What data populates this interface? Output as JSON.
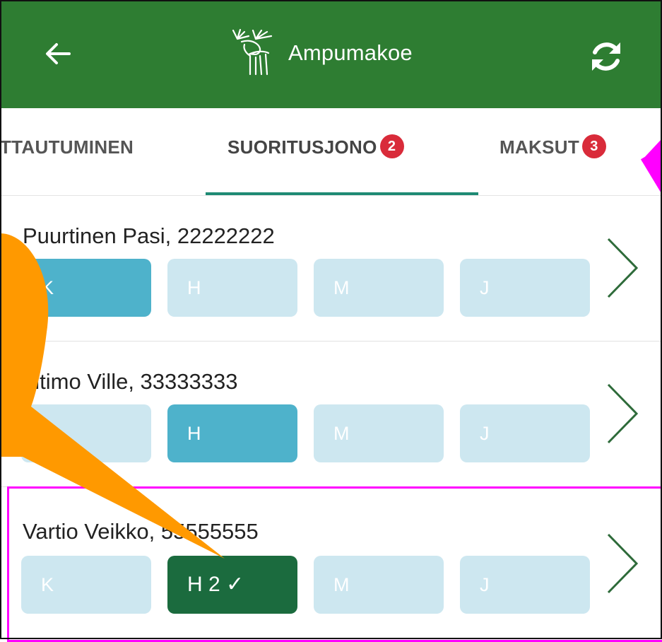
{
  "appbar": {
    "title": "Ampumakoe",
    "icons": {
      "back": "arrow-left-icon",
      "logo": "moose-logo-icon",
      "refresh": "refresh-icon"
    },
    "color": "#2e7d32"
  },
  "tabs": [
    {
      "label": "TTAUTUMINEN",
      "badge": null
    },
    {
      "label": "SUORITUSJONO",
      "badge": "2",
      "active": true
    },
    {
      "label": "MAKSUT",
      "badge": "3"
    }
  ],
  "rows": [
    {
      "name": "Puurtinen Pasi, 22222222",
      "chips": [
        "K",
        "H",
        "M",
        "J"
      ],
      "active_chip": "K"
    },
    {
      "name": "altimo Ville, 33333333",
      "chips": [
        "",
        "H",
        "M",
        "J"
      ],
      "active_chip": "H"
    },
    {
      "name": "Vartio Veikko, 55555555",
      "chips": [
        "K",
        "H 2 ✓",
        "M",
        "J"
      ],
      "done_chip": "H"
    }
  ],
  "colors": {
    "chip_inactive": "#cde7f0",
    "chip_active": "#4eb2cb",
    "chip_done": "#1b6b3e",
    "badge": "#d92b3a",
    "tab_indicator": "#1e8a74",
    "annotation_callout": "#ff9900",
    "annotation_highlight": "#ff00ff"
  }
}
